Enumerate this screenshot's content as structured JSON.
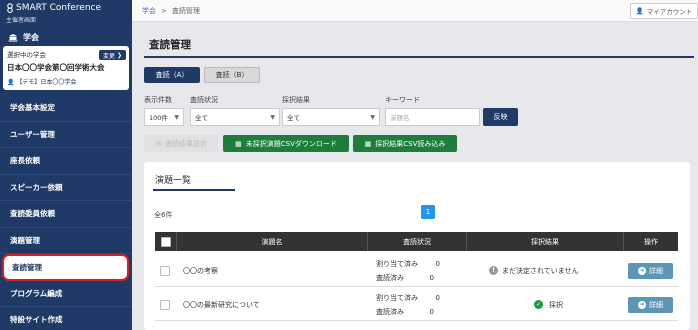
{
  "sidebar": {
    "brand": "SMART Conference",
    "role": "主催者画面",
    "section_label": "学会",
    "selected_label": "選択中の学会",
    "change_label": "変更",
    "conference_name": "日本〇〇学会第〇回学術大会",
    "user_label": "【デモ】日本〇〇学会",
    "items": [
      {
        "label": "学会基本設定"
      },
      {
        "label": "ユーザー管理"
      },
      {
        "label": "座長依頼"
      },
      {
        "label": "スピーカー依頼"
      },
      {
        "label": "査読委員依頼"
      },
      {
        "label": "演題管理"
      },
      {
        "label": "査読管理"
      },
      {
        "label": "プログラム編成"
      },
      {
        "label": "特設サイト作成"
      }
    ]
  },
  "topbar": {
    "breadcrumb_root": "学会",
    "breadcrumb_sep": ">",
    "breadcrumb_current": "査読管理",
    "account_label": "マイアカウント"
  },
  "main": {
    "title": "査読管理",
    "tabs": [
      {
        "label": "査読（A）"
      },
      {
        "label": "査読（B）"
      }
    ],
    "filters": {
      "count": {
        "label": "表示件数",
        "value": "100件"
      },
      "status": {
        "label": "査読状況",
        "value": "全て"
      },
      "result": {
        "label": "採択結果",
        "value": "全て"
      },
      "keyword": {
        "label": "キーワード",
        "placeholder": "演題名"
      },
      "apply_label": "反映"
    },
    "actions": {
      "send_result": "査読結果送信",
      "download_csv": "未採択演題CSVダウンロード",
      "import_csv": "採択結果CSV読み込み"
    },
    "list": {
      "title": "演題一覧",
      "total": "全6件",
      "page": "1",
      "headers": {
        "name": "演題名",
        "status": "査読状況",
        "result": "採択結果",
        "action": "操作"
      },
      "rows": [
        {
          "name": "〇〇の考察",
          "assigned_label": "割り当て済み",
          "assigned": "0",
          "reviewed_label": "査読済み",
          "reviewed": "0",
          "result": "まだ決定されていません",
          "detail": "詳細"
        },
        {
          "name": "〇〇の最新研究について",
          "assigned_label": "割り当て済み",
          "assigned": "0",
          "reviewed_label": "査読済み",
          "reviewed": "0",
          "result": "採択",
          "detail": "詳細"
        }
      ]
    }
  }
}
